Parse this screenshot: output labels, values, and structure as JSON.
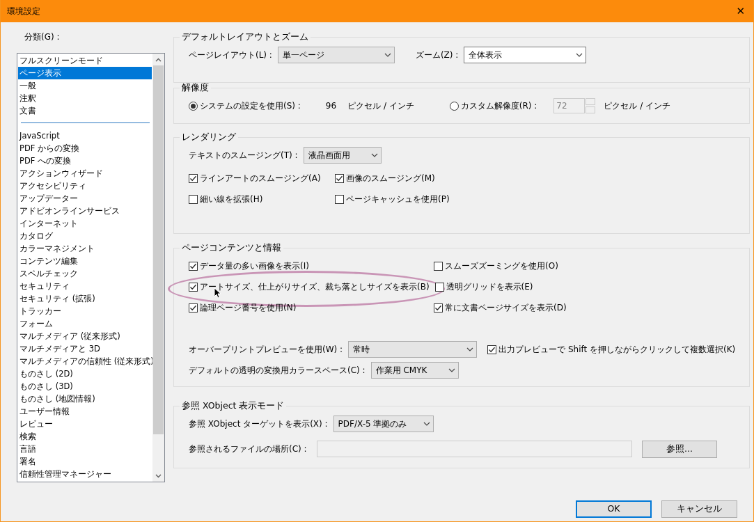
{
  "window": {
    "title": "環境設定",
    "close": "✕"
  },
  "category": {
    "label": "分類(G) :",
    "sections": [
      {
        "items": [
          {
            "label": "フルスクリーンモード",
            "selected": false
          },
          {
            "label": "ページ表示",
            "selected": true
          },
          {
            "label": "一般",
            "selected": false
          },
          {
            "label": "注釈",
            "selected": false
          },
          {
            "label": "文書",
            "selected": false
          }
        ]
      },
      {
        "items": [
          {
            "label": "JavaScript",
            "selected": false
          },
          {
            "label": "PDF からの変換",
            "selected": false
          },
          {
            "label": "PDF への変換",
            "selected": false
          },
          {
            "label": "アクションウィザード",
            "selected": false
          },
          {
            "label": "アクセシビリティ",
            "selected": false
          },
          {
            "label": "アップデーター",
            "selected": false
          },
          {
            "label": "アドビオンラインサービス",
            "selected": false
          },
          {
            "label": "インターネット",
            "selected": false
          },
          {
            "label": "カタログ",
            "selected": false
          },
          {
            "label": "カラーマネジメント",
            "selected": false
          },
          {
            "label": "コンテンツ編集",
            "selected": false
          },
          {
            "label": "スペルチェック",
            "selected": false
          },
          {
            "label": "セキュリティ",
            "selected": false
          },
          {
            "label": "セキュリティ (拡張)",
            "selected": false
          },
          {
            "label": "トラッカー",
            "selected": false
          },
          {
            "label": "フォーム",
            "selected": false
          },
          {
            "label": "マルチメディア (従来形式)",
            "selected": false
          },
          {
            "label": "マルチメディアと 3D",
            "selected": false
          },
          {
            "label": "マルチメディアの信頼性 (従来形式)",
            "selected": false
          },
          {
            "label": "ものさし (2D)",
            "selected": false
          },
          {
            "label": "ものさし (3D)",
            "selected": false
          },
          {
            "label": "ものさし (地図情報)",
            "selected": false
          },
          {
            "label": "ユーザー情報",
            "selected": false
          },
          {
            "label": "レビュー",
            "selected": false
          },
          {
            "label": "検索",
            "selected": false
          },
          {
            "label": "言語",
            "selected": false
          },
          {
            "label": "署名",
            "selected": false
          },
          {
            "label": "信頼性管理マネージャー",
            "selected": false
          }
        ]
      }
    ]
  },
  "panels": [
    {
      "title": "デフォルトレイアウトとズーム",
      "rows": [
        {
          "items": [
            {
              "kind": "dropdown",
              "label": "ページレイアウト(L) :",
              "value": "単一ページ"
            },
            {
              "kind": "combobox",
              "label": "ズーム(Z) :",
              "value": "全体表示"
            }
          ]
        }
      ]
    },
    {
      "title": "解像度",
      "rows": [
        {
          "items": [
            {
              "kind": "radio",
              "label": "システムの設定を使用(S) :",
              "selected": true
            },
            {
              "kind": "text",
              "label": "96"
            },
            {
              "kind": "text",
              "label": "ピクセル / インチ"
            },
            {
              "kind": "radio",
              "label": "カスタム解像度(R) :",
              "selected": false
            },
            {
              "kind": "spin",
              "value": "72",
              "disabled": true
            },
            {
              "kind": "text",
              "label": "ピクセル / インチ"
            }
          ]
        }
      ]
    },
    {
      "title": "レンダリング",
      "rows": [
        {
          "items": [
            {
              "kind": "dropdown",
              "label": "テキストのスムージング(T) :",
              "value": "液晶画面用"
            }
          ]
        },
        {
          "items": [
            {
              "kind": "checkbox",
              "label": "ラインアートのスムージング(A)",
              "checked": true
            },
            {
              "kind": "checkbox",
              "label": "画像のスムージング(M)",
              "checked": true
            }
          ]
        },
        {
          "items": [
            {
              "kind": "checkbox",
              "label": "細い線を拡張(H)",
              "checked": false
            },
            {
              "kind": "checkbox",
              "label": "ページキャッシュを使用(P)",
              "checked": false
            }
          ]
        }
      ]
    },
    {
      "title": "ページコンテンツと情報",
      "rows": [
        {
          "items": [
            {
              "kind": "checkbox",
              "label": "データ量の多い画像を表示(I)",
              "checked": true
            },
            {
              "kind": "checkbox",
              "label": "スムーズズーミングを使用(O)",
              "checked": false
            }
          ]
        },
        {
          "items": [
            {
              "kind": "checkbox",
              "label": "アートサイズ、仕上がりサイズ、裁ち落としサイズを表示(B)",
              "checked": true,
              "highlighted": true
            },
            {
              "kind": "checkbox",
              "label": "透明グリッドを表示(E)",
              "checked": false
            }
          ]
        },
        {
          "items": [
            {
              "kind": "checkbox",
              "label": "論理ページ番号を使用(N)",
              "checked": true
            },
            {
              "kind": "checkbox",
              "label": "常に文書ページサイズを表示(D)",
              "checked": true
            }
          ]
        },
        {
          "items": [
            {
              "kind": "dropdown",
              "label": "オーバープリントプレビューを使用(W) :",
              "value": "常時"
            },
            {
              "kind": "checkbox",
              "label": "出力プレビューで Shift を押しながらクリックして複数選択(K)",
              "checked": true
            }
          ]
        },
        {
          "items": [
            {
              "kind": "dropdown",
              "label": "デフォルトの透明の変換用カラースペース(C) :",
              "value": "作業用 CMYK"
            }
          ]
        }
      ]
    },
    {
      "title": "参照 XObject 表示モード",
      "rows": [
        {
          "items": [
            {
              "kind": "dropdown",
              "label": "参照 XObject ターゲットを表示(X) :",
              "value": "PDF/X-5 準拠のみ"
            }
          ]
        },
        {
          "items": [
            {
              "kind": "field",
              "label": "参照されるファイルの場所(C) :",
              "disabled": true
            },
            {
              "kind": "button",
              "label": "参照..."
            }
          ]
        }
      ]
    }
  ],
  "buttons": [
    {
      "label": "OK",
      "default": true
    },
    {
      "label": "キャンセル",
      "default": false
    }
  ]
}
